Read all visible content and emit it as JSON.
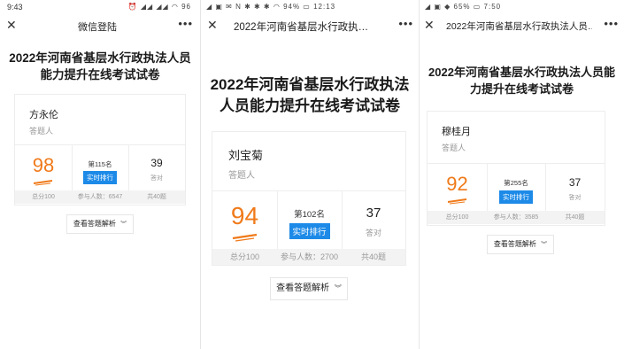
{
  "colors": {
    "score": "#f07a1a",
    "rank_button": "#1d8ae8",
    "footer_bg": "#f3f3f3"
  },
  "screens": [
    {
      "status": {
        "time": "9:43",
        "icons": "⏰  ◢◢ ◢◢ ◠ 96"
      },
      "header": {
        "close_icon": "close-icon",
        "title": "微信登陆",
        "more_icon": "more-icon"
      },
      "exam_title": "2022年河南省基层水行政执法人员能力提升在线考试试卷",
      "participant": {
        "name": "方永伦",
        "role": "答题人"
      },
      "score": "98",
      "rank": "第115名",
      "rank_button": "实时排行",
      "correct": "39",
      "correct_label": "答对",
      "footer": {
        "total": "总分100",
        "participants": "参与人数：6547",
        "questions": "共40题"
      },
      "view_analysis": "查看答题解析"
    },
    {
      "status": {
        "time": "",
        "icons": "◢ ▣ ✉ N ✱ ✱ ✱   ◠  94% ▭ 12:13"
      },
      "header": {
        "close_icon": "close-icon",
        "title": "2022年河南省基层水行政执…",
        "more_icon": "more-icon"
      },
      "exam_title": "2022年河南省基层水行政执法人员能力提升在线考试试卷",
      "participant": {
        "name": "刘宝菊",
        "role": "答题人"
      },
      "score": "94",
      "rank": "第102名",
      "rank_button": "实时排行",
      "correct": "37",
      "correct_label": "答对",
      "footer": {
        "total": "总分100",
        "participants": "参与人数：2700",
        "questions": "共40题"
      },
      "view_analysis": "查看答题解析"
    },
    {
      "status": {
        "time": "",
        "icons": "◢ ▣ ◆    65% ▭ 7:50"
      },
      "header": {
        "close_icon": "close-icon",
        "title": "2022年河南省基层水行政执法人员…",
        "more_icon": "more-icon"
      },
      "exam_title": "2022年河南省基层水行政执法人员能力提升在线考试试卷",
      "participant": {
        "name": "穆桂月",
        "role": "答题人"
      },
      "score": "92",
      "rank": "第255名",
      "rank_button": "实时排行",
      "correct": "37",
      "correct_label": "答对",
      "footer": {
        "total": "总分100",
        "participants": "参与人数：3585",
        "questions": "共40题"
      },
      "view_analysis": "查看答题解析"
    }
  ]
}
